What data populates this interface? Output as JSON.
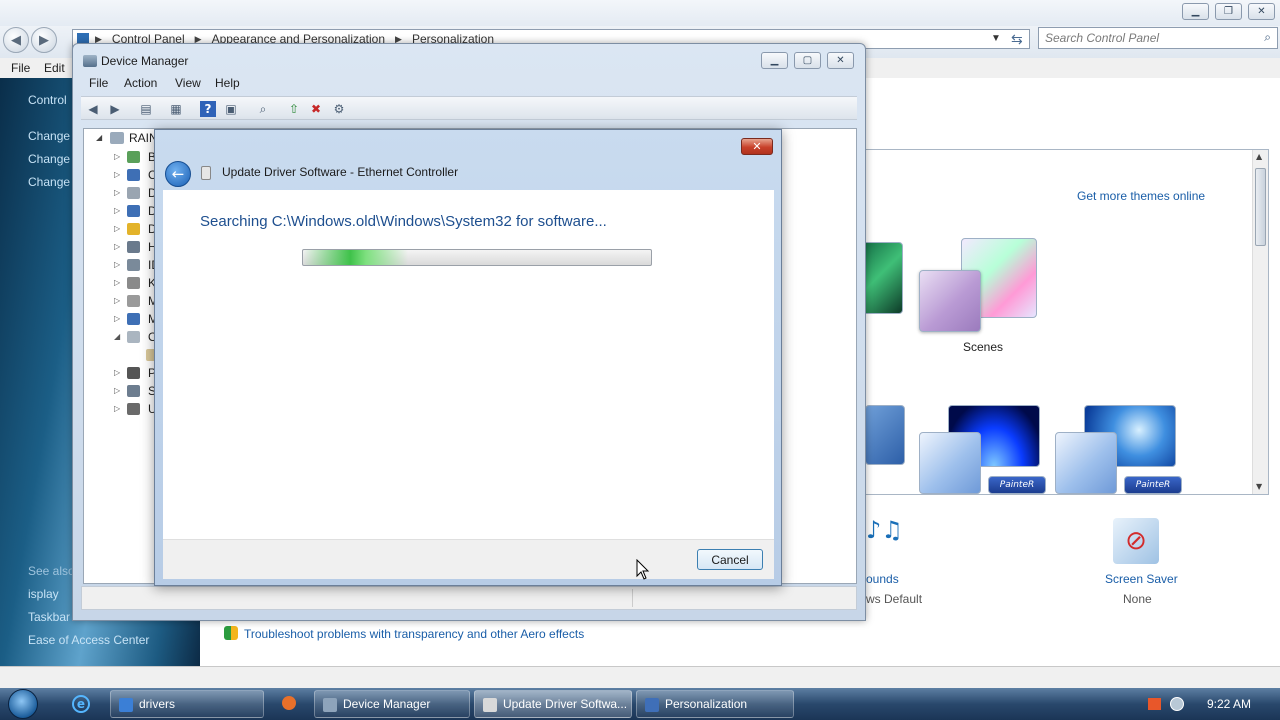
{
  "personalization": {
    "breadcrumb": [
      "Control Panel",
      "Appearance and Personalization",
      "Personalization"
    ],
    "search_placeholder": "Search Control Panel",
    "menu": [
      "File",
      "Edit"
    ],
    "left_links": [
      "Control",
      "Change",
      "Change",
      "Change"
    ],
    "see_also": {
      "heading": "See also",
      "items": [
        "isplay",
        "Taskbar",
        "Ease of Access Center"
      ]
    },
    "get_more_themes": "Get more themes online",
    "scenes_label": "Scenes",
    "sounds": {
      "label": "ounds",
      "value": "ws Default"
    },
    "screen_saver": {
      "label": "Screen Saver",
      "value": "None"
    },
    "troubleshoot_link": "Troubleshoot problems with transparency and other Aero effects",
    "painter_badge": "PainteR"
  },
  "device_manager": {
    "title": "Device Manager",
    "menu": [
      "File",
      "Action",
      "View",
      "Help"
    ],
    "tree_root": "RAIN",
    "tree_items": [
      "B",
      "C",
      "D",
      "D",
      "D",
      "H",
      "ID",
      "K",
      "M",
      "M",
      "O",
      "",
      "P",
      "S",
      "U"
    ]
  },
  "update_driver": {
    "title": "Update Driver Software - Ethernet Controller",
    "heading": "Searching C:\\Windows.old\\Windows\\System32 for software...",
    "cancel_label": "Cancel",
    "close_glyph": "✕"
  },
  "taskbar": {
    "buttons": [
      "drivers",
      "Device Manager",
      "Update Driver Softwa...",
      "Personalization"
    ],
    "clock": "9:22 AM"
  }
}
